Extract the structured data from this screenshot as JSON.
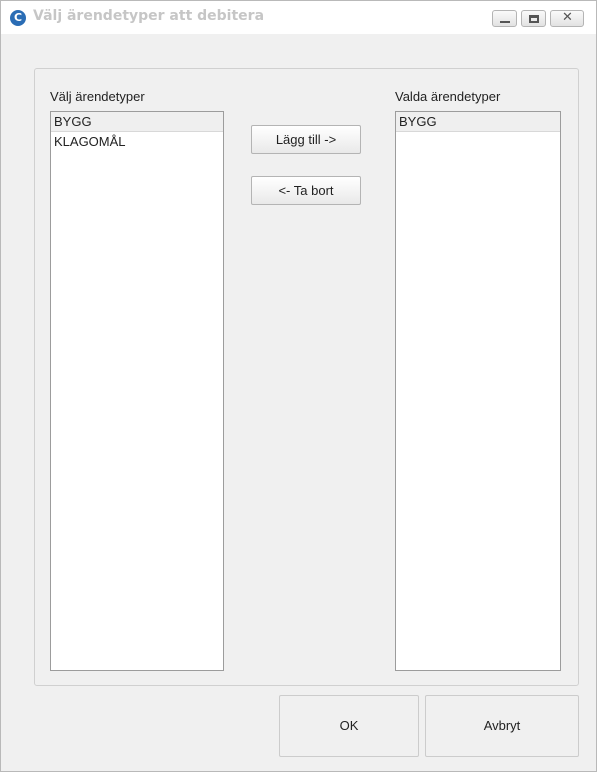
{
  "window": {
    "title": "Välj ärendetyper att debitera",
    "app_icon_letter": "C"
  },
  "available": {
    "label": "Välj ärendetyper",
    "items": [
      "BYGG",
      "KLAGOMÅL"
    ],
    "selected": "BYGG"
  },
  "chosen": {
    "label": "Valda ärendetyper",
    "items": [
      "BYGG"
    ],
    "selected": "BYGG"
  },
  "buttons": {
    "add": "Lägg till ->",
    "remove": "<- Ta bort",
    "ok": "OK",
    "cancel": "Avbryt"
  },
  "icons": {
    "minimize": "minimize-icon",
    "maximize": "maximize-icon",
    "close": "close-icon"
  }
}
